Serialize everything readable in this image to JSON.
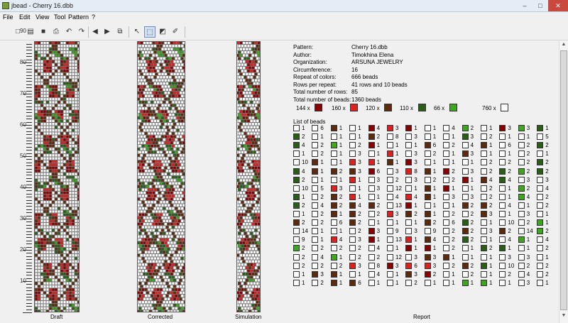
{
  "window": {
    "title": "jbead - Cherry 16.dbb",
    "min": "–",
    "max": "□",
    "close": "✕",
    "icon": "jbead-app-icon"
  },
  "menu": [
    "File",
    "Edit",
    "View",
    "Tool",
    "Pattern",
    "?"
  ],
  "toolbar": {
    "buttons": [
      {
        "name": "new-icon",
        "glyph": "□"
      },
      {
        "name": "open-icon",
        "glyph": "▤"
      },
      {
        "name": "save-icon",
        "glyph": "■"
      },
      {
        "name": "print-icon",
        "glyph": "⎙"
      },
      {
        "name": "undo-icon",
        "glyph": "↶"
      },
      {
        "name": "redo-icon",
        "glyph": "↷"
      },
      {
        "name": "rotate-left-icon",
        "glyph": "◀"
      },
      {
        "name": "rotate-right-icon",
        "glyph": "▶"
      },
      {
        "name": "arrange-icon",
        "glyph": "⧉"
      },
      {
        "name": "pointer-icon",
        "glyph": "↖"
      },
      {
        "name": "select-icon",
        "glyph": "⬚"
      },
      {
        "name": "fill-icon",
        "glyph": "◩"
      },
      {
        "name": "pipette-icon",
        "glyph": "✐"
      }
    ],
    "palette": [
      "#ffffff",
      "#8b0000",
      "#cc1f1f",
      "#6b2e12",
      "#1f6b1f",
      "#2f9e2f",
      "#ffff66",
      "#f2f2f2",
      "#7b3fa0",
      "#2b2bb8",
      "#1a1a8a",
      "#1a1a1a",
      "#000000",
      "#f4a6b8",
      "#ff7f7f",
      "#ffffff",
      "#66cc66",
      "#99ff99",
      "#ffcc66",
      "#ff66cc",
      "#9999ff",
      "#66ccff",
      "#9ad",
      "#5a7a9a"
    ]
  },
  "pattern_colors": {
    "bg": "#ffffff",
    "dark_red": "#8b0000",
    "red": "#e01f1f",
    "brown": "#5e2a0e",
    "dark_green": "#2a5e17",
    "green": "#3ea61f"
  },
  "ruler": [
    "90",
    "80",
    "70",
    "60",
    "50",
    "40",
    "30",
    "20",
    "10"
  ],
  "labels": {
    "draft": "Draft",
    "corrected": "Corrected",
    "simulation": "Simulation",
    "report": "Report",
    "list": "List of beads"
  },
  "info": [
    {
      "k": "Pattern:",
      "v": "Cherry 16.dbb"
    },
    {
      "k": "Author:",
      "v": "Timokhina Elena"
    },
    {
      "k": "Organization:",
      "v": "ARSUNA JEWELRY"
    },
    {
      "k": "Circumference:",
      "v": "16"
    },
    {
      "k": "Repeat of colors:",
      "v": "666 beads"
    },
    {
      "k": "Rows per repeat:",
      "v": "41 rows and 10 beads"
    },
    {
      "k": "Total number of rows:",
      "v": "85"
    },
    {
      "k": "Total number of beads:",
      "v": "1360 beads"
    }
  ],
  "summary": [
    {
      "text": "144 x",
      "color": "#8b0000"
    },
    {
      "text": "160 x",
      "color": "#e01f1f"
    },
    {
      "text": "120 x",
      "color": "#5e2a0e"
    },
    {
      "text": "110 x",
      "color": "#2a5e17"
    },
    {
      "text": "66 x",
      "color": "#3ea61f"
    },
    {
      "text": "760 x",
      "color": "#ffffff"
    }
  ],
  "bead_list": [
    [
      [
        "w",
        "1"
      ],
      [
        "dg",
        "2"
      ],
      [
        "dg",
        "4"
      ],
      [
        "w",
        "1"
      ],
      [
        "w",
        "10"
      ],
      [
        "dg",
        "4"
      ],
      [
        "dg",
        "2"
      ],
      [
        "w",
        "10"
      ],
      [
        "dg",
        "1"
      ],
      [
        "dg",
        "2"
      ],
      [
        "w",
        "1"
      ],
      [
        "br",
        "2"
      ],
      [
        "w",
        "14"
      ],
      [
        "w",
        "9"
      ],
      [
        "g",
        "2"
      ],
      [
        "w",
        "2"
      ],
      [
        "w",
        "2"
      ],
      [
        "w",
        "1"
      ],
      [
        "w",
        "1"
      ]
    ],
    [
      [
        "w",
        "6"
      ],
      [
        "w",
        "1"
      ],
      [
        "w",
        "2"
      ],
      [
        "w",
        "2"
      ],
      [
        "br",
        "1"
      ],
      [
        "br",
        "1"
      ],
      [
        "w",
        "1"
      ],
      [
        "w",
        "5"
      ],
      [
        "w",
        "2"
      ],
      [
        "w",
        "4"
      ],
      [
        "w",
        "2"
      ],
      [
        "w",
        "2"
      ],
      [
        "w",
        "1"
      ],
      [
        "w",
        "1"
      ],
      [
        "w",
        "2"
      ],
      [
        "w",
        "4"
      ],
      [
        "w",
        "2"
      ],
      [
        "br",
        "3"
      ],
      [
        "w",
        "2"
      ]
    ],
    [
      [
        "br",
        "1"
      ],
      [
        "w",
        "1"
      ],
      [
        "g",
        "1"
      ],
      [
        "w",
        "1"
      ],
      [
        "w",
        "1"
      ],
      [
        "br",
        "2"
      ],
      [
        "w",
        "1"
      ],
      [
        "r",
        "3"
      ],
      [
        "br",
        "2"
      ],
      [
        "br",
        "2"
      ],
      [
        "br",
        "1"
      ],
      [
        "w",
        "6"
      ],
      [
        "w",
        "1"
      ],
      [
        "r",
        "4"
      ],
      [
        "w",
        "2"
      ],
      [
        "g",
        "1"
      ],
      [
        "w",
        "2"
      ],
      [
        "br",
        "1"
      ],
      [
        "br",
        "1"
      ]
    ],
    [
      [
        "w",
        "1"
      ],
      [
        "w",
        "1"
      ],
      [
        "w",
        "2"
      ],
      [
        "w",
        "3"
      ],
      [
        "r",
        "3"
      ],
      [
        "br",
        "3"
      ],
      [
        "r",
        "1"
      ],
      [
        "w",
        "1"
      ],
      [
        "r",
        "1"
      ],
      [
        "br",
        "4"
      ],
      [
        "br",
        "2"
      ],
      [
        "br",
        "2"
      ],
      [
        "w",
        "2"
      ],
      [
        "w",
        "3"
      ],
      [
        "w",
        "2"
      ],
      [
        "w",
        "2"
      ],
      [
        "r",
        "3"
      ],
      [
        "w",
        "1"
      ],
      [
        "br",
        "6"
      ]
    ],
    [
      [
        "dr",
        "4"
      ],
      [
        "br",
        "2"
      ],
      [
        "dr",
        "1"
      ],
      [
        "w",
        "1"
      ],
      [
        "r",
        "1"
      ],
      [
        "dr",
        "6"
      ],
      [
        "w",
        "3"
      ],
      [
        "w",
        "3"
      ],
      [
        "w",
        "1"
      ],
      [
        "br",
        "2"
      ],
      [
        "w",
        "2"
      ],
      [
        "w",
        "1"
      ],
      [
        "dr",
        "3"
      ],
      [
        "dr",
        "1"
      ],
      [
        "w",
        "4"
      ],
      [
        "w",
        "2"
      ],
      [
        "w",
        "8"
      ],
      [
        "w",
        "4"
      ],
      [
        "w",
        "1"
      ]
    ],
    [
      [
        "r",
        "3"
      ],
      [
        "w",
        "8"
      ],
      [
        "w",
        "1"
      ],
      [
        "r",
        "1"
      ],
      [
        "br",
        "1"
      ],
      [
        "w",
        "3"
      ],
      [
        "w",
        "2"
      ],
      [
        "w",
        "12"
      ],
      [
        "w",
        "4"
      ],
      [
        "w",
        "13"
      ],
      [
        "r",
        "3"
      ],
      [
        "w",
        "1"
      ],
      [
        "w",
        "9"
      ],
      [
        "w",
        "13"
      ],
      [
        "w",
        "1"
      ],
      [
        "w",
        "12"
      ],
      [
        "dr",
        "3"
      ],
      [
        "w",
        "1"
      ],
      [
        "w",
        "1"
      ]
    ],
    [
      [
        "dr",
        "1"
      ],
      [
        "w",
        "3"
      ],
      [
        "w",
        "1"
      ],
      [
        "w",
        "3"
      ],
      [
        "dr",
        "3"
      ],
      [
        "r",
        "8"
      ],
      [
        "w",
        "3"
      ],
      [
        "w",
        "1"
      ],
      [
        "r",
        "4"
      ],
      [
        "dr",
        "1"
      ],
      [
        "br",
        "2"
      ],
      [
        "w",
        "1"
      ],
      [
        "w",
        "3"
      ],
      [
        "r",
        "1"
      ],
      [
        "dr",
        "1"
      ],
      [
        "w",
        "3"
      ],
      [
        "r",
        "6"
      ],
      [
        "br",
        "3"
      ],
      [
        "w",
        "2"
      ]
    ],
    [
      [
        "w",
        "1"
      ],
      [
        "w",
        "1"
      ],
      [
        "br",
        "6"
      ],
      [
        "w",
        "2"
      ],
      [
        "w",
        "1"
      ],
      [
        "br",
        "1"
      ],
      [
        "w",
        "2"
      ],
      [
        "br",
        "1"
      ],
      [
        "br",
        "1"
      ],
      [
        "w",
        "1"
      ],
      [
        "br",
        "1"
      ],
      [
        "br",
        "2"
      ],
      [
        "w",
        "9"
      ],
      [
        "br",
        "4"
      ],
      [
        "dr",
        "1"
      ],
      [
        "br",
        "3"
      ],
      [
        "r",
        "3"
      ],
      [
        "dr",
        "2"
      ],
      [
        "w",
        "1"
      ]
    ],
    [
      [
        "w",
        "4"
      ],
      [
        "w",
        "1"
      ],
      [
        "w",
        "2"
      ],
      [
        "w",
        "1"
      ],
      [
        "w",
        "1"
      ],
      [
        "dr",
        "2"
      ],
      [
        "w",
        "2"
      ],
      [
        "dr",
        "1"
      ],
      [
        "w",
        "3"
      ],
      [
        "w",
        "1"
      ],
      [
        "w",
        "2"
      ],
      [
        "w",
        "6"
      ],
      [
        "w",
        "2"
      ],
      [
        "w",
        "2"
      ],
      [
        "w",
        "2"
      ],
      [
        "br",
        "1"
      ],
      [
        "w",
        "2"
      ],
      [
        "w",
        "1"
      ],
      [
        "w",
        "1"
      ]
    ],
    [
      [
        "g",
        "2"
      ],
      [
        "dg",
        "3"
      ],
      [
        "w",
        "4"
      ],
      [
        "br",
        "3"
      ],
      [
        "w",
        "1"
      ],
      [
        "w",
        "3"
      ],
      [
        "dr",
        "1"
      ],
      [
        "w",
        "1"
      ],
      [
        "w",
        "3"
      ],
      [
        "br",
        "2"
      ],
      [
        "w",
        "2"
      ],
      [
        "dg",
        "2"
      ],
      [
        "br",
        "2"
      ],
      [
        "dg",
        "2"
      ],
      [
        "w",
        "1"
      ],
      [
        "w",
        "1"
      ],
      [
        "br",
        "2"
      ],
      [
        "w",
        "2"
      ],
      [
        "g",
        "1"
      ]
    ],
    [
      [
        "w",
        "1"
      ],
      [
        "w",
        "2"
      ],
      [
        "br",
        "1"
      ],
      [
        "w",
        "1"
      ],
      [
        "w",
        "2"
      ],
      [
        "w",
        "2"
      ],
      [
        "br",
        "4"
      ],
      [
        "w",
        "2"
      ],
      [
        "w",
        "2"
      ],
      [
        "br",
        "2"
      ],
      [
        "br",
        "3"
      ],
      [
        "w",
        "1"
      ],
      [
        "w",
        "3"
      ],
      [
        "w",
        "1"
      ],
      [
        "dg",
        "2"
      ],
      [
        "w",
        "1"
      ],
      [
        "dg",
        "1"
      ],
      [
        "w",
        "1"
      ],
      [
        "g",
        "1"
      ]
    ],
    [
      [
        "dr",
        "3"
      ],
      [
        "w",
        "1"
      ],
      [
        "w",
        "6"
      ],
      [
        "w",
        "1"
      ],
      [
        "w",
        "2"
      ],
      [
        "dg",
        "2"
      ],
      [
        "dg",
        "4"
      ],
      [
        "w",
        "1"
      ],
      [
        "w",
        "1"
      ],
      [
        "w",
        "4"
      ],
      [
        "w",
        "1"
      ],
      [
        "w",
        "10"
      ],
      [
        "br",
        "2"
      ],
      [
        "w",
        "4"
      ],
      [
        "dg",
        "1"
      ],
      [
        "w",
        "3"
      ],
      [
        "w",
        "10"
      ],
      [
        "w",
        "2"
      ],
      [
        "w",
        "1"
      ]
    ],
    [
      [
        "g",
        "3"
      ],
      [
        "w",
        "1"
      ],
      [
        "w",
        "2"
      ],
      [
        "w",
        "2"
      ],
      [
        "w",
        "2"
      ],
      [
        "g",
        "2"
      ],
      [
        "w",
        "3"
      ],
      [
        "g",
        "2"
      ],
      [
        "g",
        "4"
      ],
      [
        "w",
        "1"
      ],
      [
        "w",
        "3"
      ],
      [
        "w",
        "2"
      ],
      [
        "w",
        "14"
      ],
      [
        "g",
        "1"
      ],
      [
        "w",
        "1"
      ],
      [
        "w",
        "3"
      ],
      [
        "w",
        "2"
      ],
      [
        "w",
        "4"
      ],
      [
        "w",
        "3"
      ]
    ],
    [
      [
        "dg",
        "1"
      ],
      [
        "w",
        "5"
      ],
      [
        "dg",
        "2"
      ],
      [
        "w",
        "1"
      ],
      [
        "dg",
        "2"
      ],
      [
        "dg",
        "2"
      ],
      [
        "w",
        "3"
      ],
      [
        "w",
        "4"
      ],
      [
        "w",
        "2"
      ],
      [
        "w",
        "2"
      ],
      [
        "w",
        "1"
      ],
      [
        "g",
        "1"
      ],
      [
        "g",
        "2"
      ],
      [
        "w",
        "4"
      ],
      [
        "w",
        "2"
      ],
      [
        "w",
        "1"
      ],
      [
        "w",
        "2"
      ],
      [
        "w",
        "2"
      ],
      [
        "w",
        "1"
      ]
    ]
  ]
}
